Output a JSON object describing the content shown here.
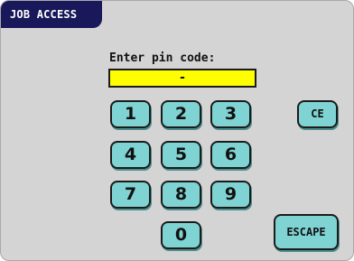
{
  "header": {
    "title": "JOB ACCESS"
  },
  "pin": {
    "label": "Enter pin code:",
    "value": "-"
  },
  "keypad": {
    "keys": [
      "1",
      "2",
      "3",
      "4",
      "5",
      "6",
      "7",
      "8",
      "9",
      "0"
    ]
  },
  "actions": {
    "clear_label": "CE",
    "escape_label": "ESCAPE"
  },
  "colors": {
    "title_bar": "#18185a",
    "background": "#d4d4d4",
    "pin_field": "#fffe00",
    "key_fill": "#7fd3d3"
  }
}
